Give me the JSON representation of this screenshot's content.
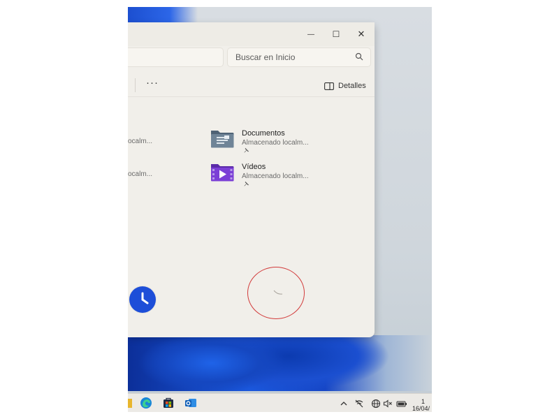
{
  "window": {
    "controls": {
      "minimize": "—",
      "maximize": "☐",
      "close": "✕"
    }
  },
  "search": {
    "placeholder": "Buscar en Inicio"
  },
  "commandbar": {
    "more_label": "···",
    "details_label": "Detalles"
  },
  "left_items_truncated": [
    {
      "sub": "ocalm..."
    },
    {
      "sub": "ocalm..."
    }
  ],
  "items": [
    {
      "name": "Documentos",
      "sub": "Almacenado localm...",
      "icon": "documents-folder-icon"
    },
    {
      "name": "Vídeos",
      "sub": "Almacenado localm...",
      "icon": "videos-folder-icon"
    }
  ],
  "taskbar": {
    "clock_time": "1",
    "clock_date": "16/04/"
  },
  "colors": {
    "accent_blue": "#1d4ed8",
    "videos_purple": "#7b3fd6",
    "documents_slate": "#5e7183",
    "annotation_red": "#d23b3b"
  }
}
